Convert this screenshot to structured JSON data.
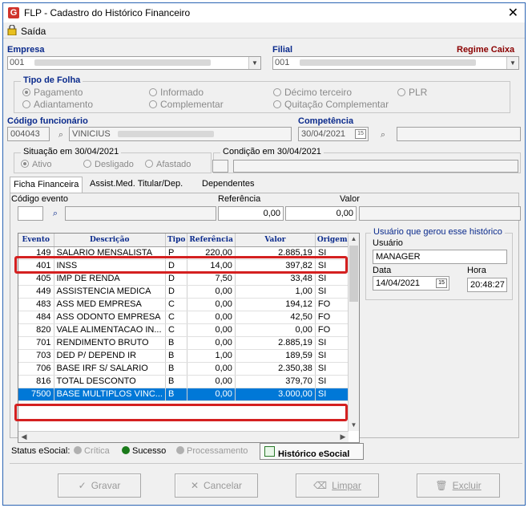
{
  "window": {
    "title": "FLP - Cadastro do Histórico Financeiro",
    "close": "✕",
    "app_icon": "G",
    "menu": {
      "saida": "Saída"
    }
  },
  "empresa": {
    "label": "Empresa",
    "value": "001"
  },
  "filial": {
    "label": "Filial",
    "value": "001"
  },
  "regime": "Regime Caixa",
  "tipo_folha": {
    "title": "Tipo de Folha",
    "options": [
      "Pagamento",
      "Informado",
      "Décimo terceiro",
      "PLR",
      "Adiantamento",
      "Complementar",
      "Quitação Complementar"
    ],
    "selected": "Pagamento"
  },
  "funcionario": {
    "label": "Código funcionário",
    "code": "004043",
    "name": "VINICIUS"
  },
  "competencia": {
    "label": "Competência",
    "value": "30/04/2021"
  },
  "situacao": {
    "title": "Situação em  30/04/2021",
    "options": [
      "Ativo",
      "Desligado",
      "Afastado"
    ],
    "selected": "Ativo"
  },
  "condicao": {
    "title": "Condição em 30/04/2021"
  },
  "tabs": [
    "Ficha Financeira",
    "Assist.Med. Titular/Dep.",
    "Dependentes"
  ],
  "filters": {
    "codigo_evento_label": "Código evento",
    "referencia_label": "Referência",
    "referencia_value": "0,00",
    "valor_label": "Valor",
    "valor_value": "0,00"
  },
  "grid": {
    "columns": [
      "Evento",
      "Descrição",
      "Tipo",
      "Referência",
      "Valor",
      "Origem"
    ],
    "rows": [
      [
        "149",
        "SALARIO MENSALISTA",
        "P",
        "220,00",
        "2.885,19",
        "SI"
      ],
      [
        "401",
        "INSS",
        "D",
        "14,00",
        "397,82",
        "SI"
      ],
      [
        "405",
        "IMP DE RENDA",
        "D",
        "7,50",
        "33,48",
        "SI"
      ],
      [
        "449",
        "ASSISTENCIA MEDICA",
        "D",
        "0,00",
        "1,00",
        "SI"
      ],
      [
        "483",
        "ASS MED EMPRESA",
        "C",
        "0,00",
        "194,12",
        "FO"
      ],
      [
        "484",
        "ASS ODONTO EMPRESA",
        "C",
        "0,00",
        "42,50",
        "FO"
      ],
      [
        "820",
        "VALE ALIMENTACAO IN...",
        "C",
        "0,00",
        "0,00",
        "FO"
      ],
      [
        "701",
        "RENDIMENTO BRUTO",
        "B",
        "0,00",
        "2.885,19",
        "SI"
      ],
      [
        "703",
        "DED P/ DEPEND IR",
        "B",
        "1,00",
        "189,59",
        "SI"
      ],
      [
        "706",
        "BASE IRF S/ SALARIO",
        "B",
        "0,00",
        "2.350,38",
        "SI"
      ],
      [
        "816",
        "TOTAL DESCONTO",
        "B",
        "0,00",
        "379,70",
        "SI"
      ],
      [
        "7500",
        "BASE MULTIPLOS VINC...",
        "B",
        "0,00",
        "3.000,00",
        "SI"
      ]
    ],
    "selected_row": 11
  },
  "usuario_group": {
    "title": "Usuário que gerou esse histórico",
    "usuario_label": "Usuário",
    "usuario_value": "MANAGER",
    "data_label": "Data",
    "data_value": "14/04/2021",
    "hora_label": "Hora",
    "hora_value": "20:48:27"
  },
  "status": {
    "label": "Status eSocial:",
    "critica": "Crítica",
    "sucesso": "Sucesso",
    "processamento": "Processamento",
    "historico": "Histórico eSocial",
    "colors": {
      "critica": "#b0b0b0",
      "sucesso": "#1a7a1a",
      "processamento": "#b0b0b0"
    }
  },
  "buttons": {
    "gravar": "Gravar",
    "cancelar": "Cancelar",
    "limpar": "Limpar",
    "excluir": "Excluir"
  },
  "highlight_color": "#d42020"
}
